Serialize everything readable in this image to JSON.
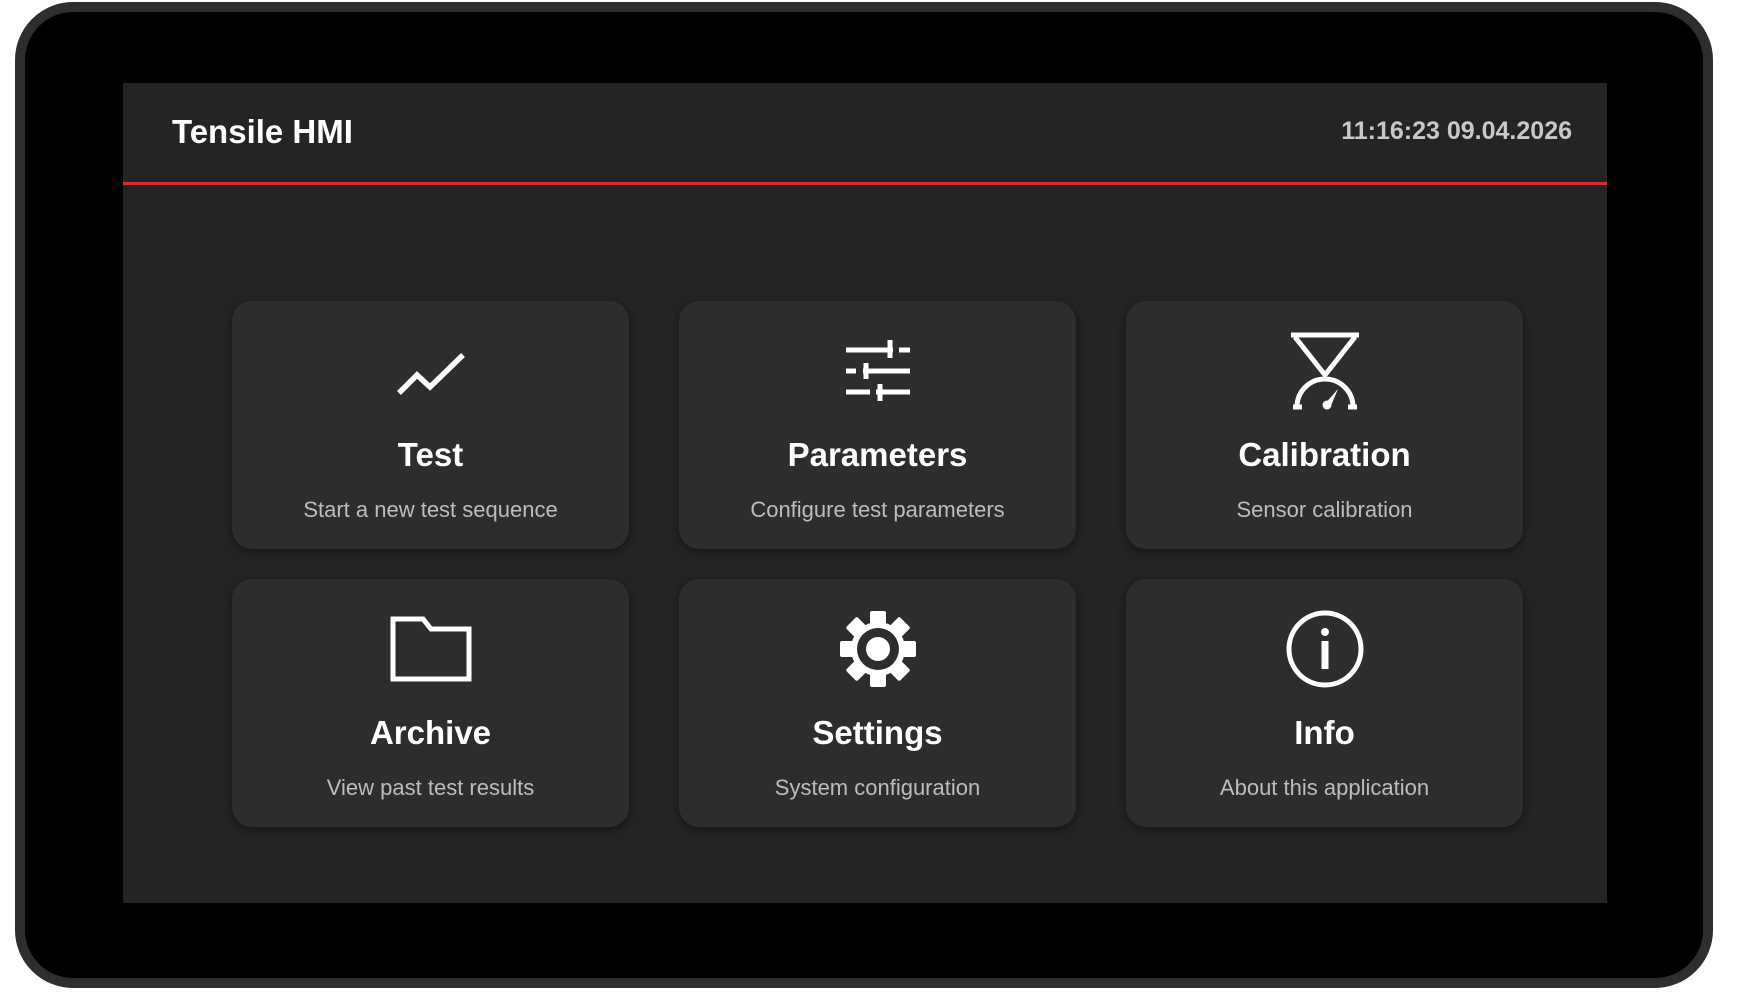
{
  "header": {
    "title": "Tensile HMI",
    "clock": "11:16:23 09.04.2026"
  },
  "colors": {
    "accent": "#d32f2f",
    "screen_bg": "#242424",
    "tile_bg": "#2d2d2d",
    "bezel": "#000000"
  },
  "tiles": [
    {
      "icon": "chart-line-icon",
      "title": "Test",
      "description": "Start a new test sequence"
    },
    {
      "icon": "sliders-icon",
      "title": "Parameters",
      "description": "Configure test parameters"
    },
    {
      "icon": "scale-gauge-icon",
      "title": "Calibration",
      "description": "Sensor calibration"
    },
    {
      "icon": "folder-icon",
      "title": "Archive",
      "description": "View past test results"
    },
    {
      "icon": "gear-icon",
      "title": "Settings",
      "description": "System configuration"
    },
    {
      "icon": "info-icon",
      "title": "Info",
      "description": "About this application"
    }
  ]
}
